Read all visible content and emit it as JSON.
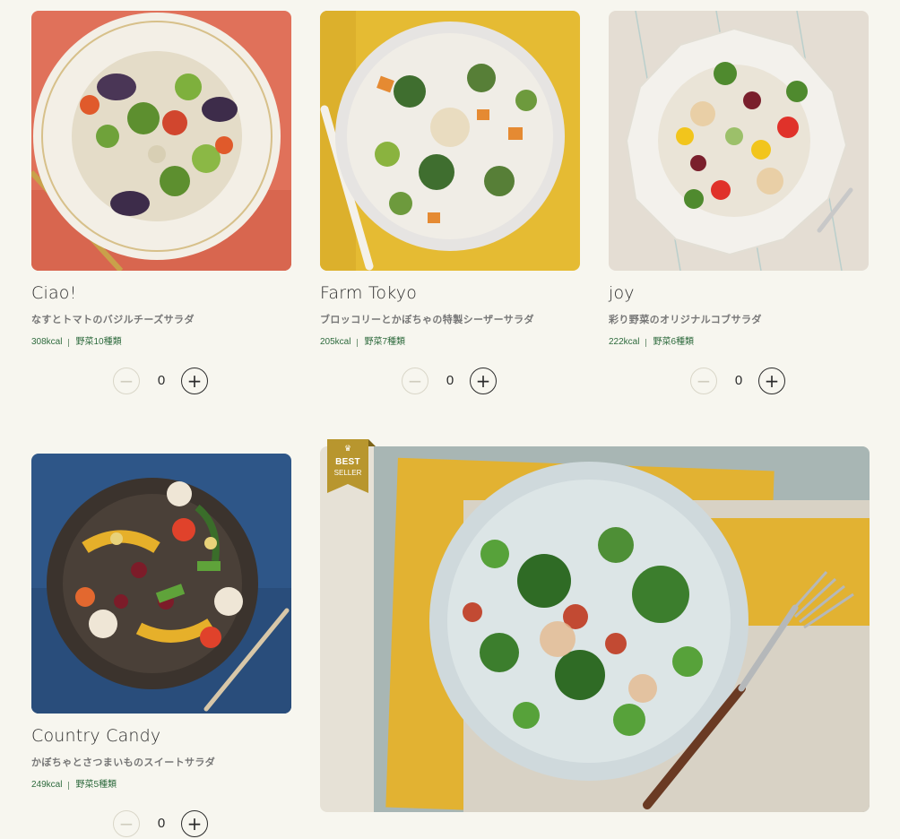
{
  "products": [
    {
      "name": "Ciao!",
      "description": "なすとトマトのバジルチーズサラダ",
      "calories": "308kcal",
      "vegetables": "野菜10種類",
      "quantity": "0",
      "minus_label": "−",
      "plus_label": "+"
    },
    {
      "name": "Farm Tokyo",
      "description": "ブロッコリーとかぼちゃの特製シーザーサラダ",
      "calories": "205kcal",
      "vegetables": "野菜7種類",
      "quantity": "0",
      "minus_label": "−",
      "plus_label": "+"
    },
    {
      "name": "joy",
      "description": "彩り野菜のオリジナルコブサラダ",
      "calories": "222kcal",
      "vegetables": "野菜6種類",
      "quantity": "0",
      "minus_label": "−",
      "plus_label": "+"
    },
    {
      "name": "Country Candy",
      "description": "かぼちゃとさつまいものスイートサラダ",
      "calories": "249kcal",
      "vegetables": "野菜5種類",
      "quantity": "0",
      "minus_label": "−",
      "plus_label": "+"
    }
  ],
  "featured": {
    "badge_icon": "♛",
    "badge_line1": "BEST",
    "badge_line2": "SELLER"
  },
  "colors": {
    "background": "#f7f6ef",
    "accent_green": "#2f6b3e",
    "badge_gold": "#b8962e"
  }
}
